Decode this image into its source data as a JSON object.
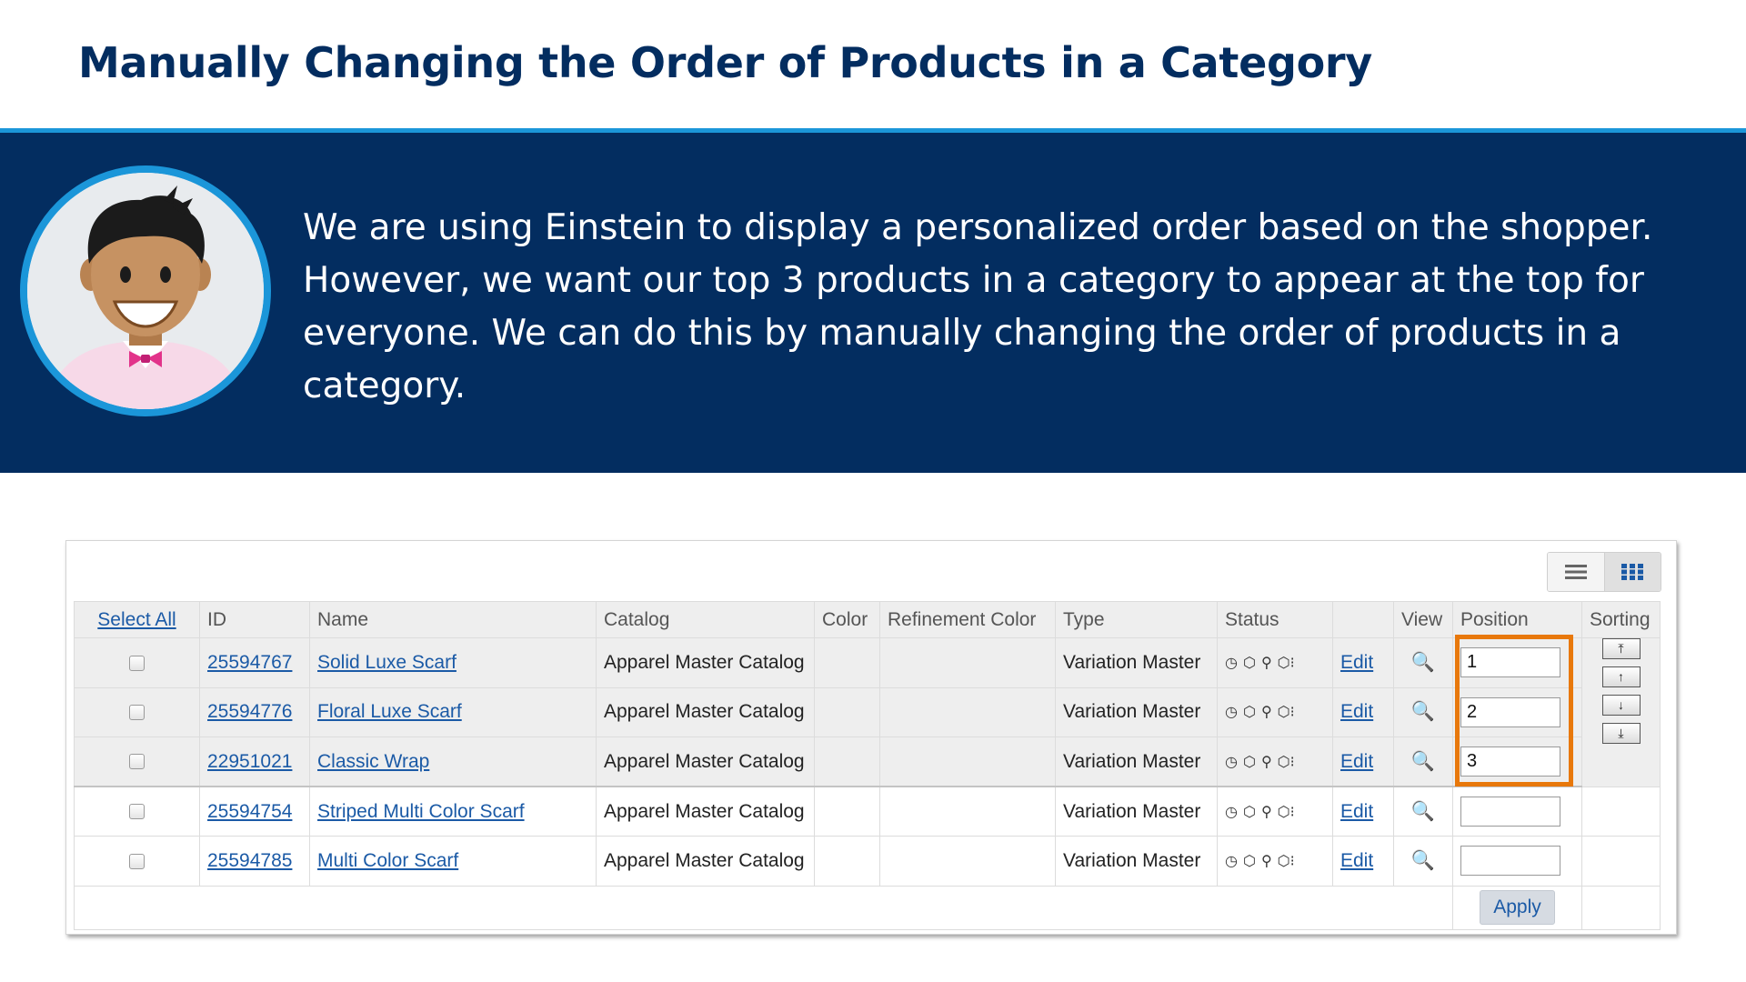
{
  "slide": {
    "title": "Manually Changing the Order of Products in a Category",
    "body": "We are using Einstein to display a personalized order based on the shopper. However, we want our top 3 products in a category to appear at the top for everyone. We can do this by manually changing the order of products in a category."
  },
  "colors": {
    "title": "#032d60",
    "banner": "#032d60",
    "accent": "#1b96d9",
    "highlight": "#e8780b",
    "link": "#1b5aa6"
  },
  "table": {
    "headers": {
      "select_all": "Select All",
      "id": "ID",
      "name": "Name",
      "catalog": "Catalog",
      "color": "Color",
      "refinement_color": "Refinement Color",
      "type": "Type",
      "status": "Status",
      "edit": "",
      "view": "View",
      "position": "Position",
      "sorting": "Sorting"
    },
    "rows": [
      {
        "id": "25594767",
        "name": "Solid Luxe Scarf",
        "catalog": "Apparel Master Catalog",
        "color": "",
        "refinement_color": "",
        "type": "Variation Master",
        "edit": "Edit",
        "position": "1"
      },
      {
        "id": "25594776",
        "name": "Floral Luxe Scarf",
        "catalog": "Apparel Master Catalog",
        "color": "",
        "refinement_color": "",
        "type": "Variation Master",
        "edit": "Edit",
        "position": "2"
      },
      {
        "id": "22951021",
        "name": "Classic Wrap",
        "catalog": "Apparel Master Catalog",
        "color": "",
        "refinement_color": "",
        "type": "Variation Master",
        "edit": "Edit",
        "position": "3"
      },
      {
        "id": "25594754",
        "name": "Striped Multi Color Scarf",
        "catalog": "Apparel Master Catalog",
        "color": "",
        "refinement_color": "",
        "type": "Variation Master",
        "edit": "Edit",
        "position": ""
      },
      {
        "id": "25594785",
        "name": "Multi Color Scarf",
        "catalog": "Apparel Master Catalog",
        "color": "",
        "refinement_color": "",
        "type": "Variation Master",
        "edit": "Edit",
        "position": ""
      }
    ],
    "status_icons": [
      "online-status-icon",
      "cube-icon",
      "search-status-icon",
      "variation-icon"
    ],
    "view_icon": "magnify-view-icon",
    "sorting_buttons": [
      "move-to-top-icon",
      "move-up-icon",
      "move-down-icon",
      "move-to-bottom-icon"
    ],
    "apply_label": "Apply"
  },
  "view_toggle": {
    "options": [
      "list-view-icon",
      "grid-view-icon"
    ],
    "selected": "grid-view-icon"
  }
}
